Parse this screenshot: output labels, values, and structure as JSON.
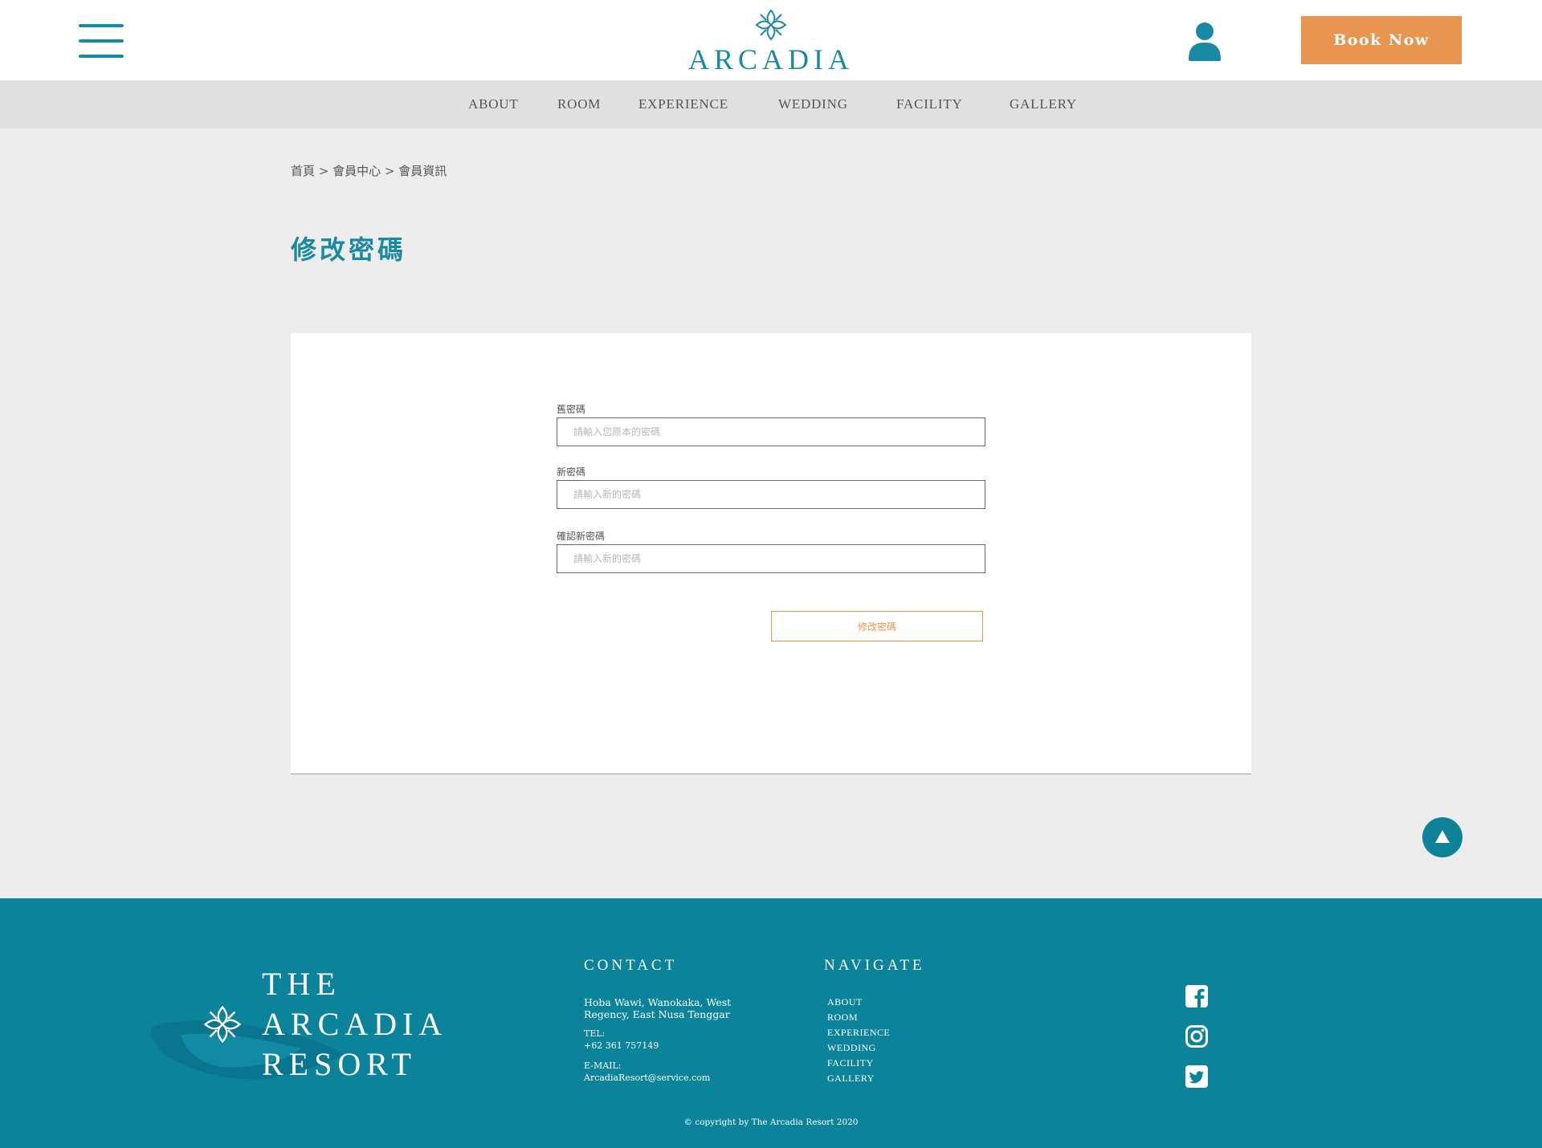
{
  "header": {
    "menu_icon": "hamburger-menu-icon",
    "logo_text": "ARCADIA",
    "user_icon": "user-icon",
    "book_now_label": "Book Now",
    "colors": {
      "brand": "#1a8aa4",
      "accent": "#e8964f"
    }
  },
  "nav": {
    "items": [
      {
        "label": "ABOUT"
      },
      {
        "label": "ROOM"
      },
      {
        "label": "EXPERIENCE"
      },
      {
        "label": "WEDDING"
      },
      {
        "label": "FACILITY"
      },
      {
        "label": "GALLERY"
      }
    ]
  },
  "breadcrumb": "首頁 > 會員中心 > 會員資訊",
  "page_title": "修改密碼",
  "form": {
    "fields": [
      {
        "label": "舊密碼",
        "placeholder": "請輸入您原本的密碼",
        "value": ""
      },
      {
        "label": "新密碼",
        "placeholder": "請輸入新的密碼",
        "value": ""
      },
      {
        "label": "確認新密碼",
        "placeholder": "請輸入新的密碼",
        "value": ""
      }
    ],
    "submit_label": "修改密碼"
  },
  "back_to_top_icon": "arrow-up-icon",
  "footer": {
    "resort_name": [
      "THE",
      "ARCADIA",
      "RESORT"
    ],
    "contact": {
      "heading": "CONTACT",
      "address": "Hoba Wawi, Wanokaka, West Regency, East Nusa Tenggar",
      "tel_label": "TEL:",
      "tel": "+62 361 757149",
      "email_label": "E-MAIL:",
      "email": "ArcadiaResort@service.com"
    },
    "navigate": {
      "heading": "NAVIGATE",
      "links": [
        "ABOUT",
        "ROOM",
        "EXPERIENCE",
        "WEDDING",
        "FACILITY",
        "GALLERY"
      ]
    },
    "social_icons": [
      "facebook-icon",
      "instagram-icon",
      "twitter-icon"
    ],
    "copyright": "© copyright by The Arcadia Resort 2020",
    "colors": {
      "background": "#0b849b"
    }
  }
}
